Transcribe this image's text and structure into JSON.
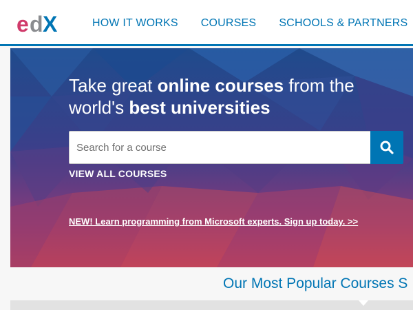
{
  "logo": {
    "text": "edX",
    "colors": {
      "e": "#d03a6a",
      "d": "#8a8c8f",
      "x": "#0075b4"
    }
  },
  "nav": {
    "items": [
      {
        "label": "HOW IT WORKS"
      },
      {
        "label": "COURSES"
      },
      {
        "label": "SCHOOLS & PARTNERS"
      }
    ]
  },
  "hero": {
    "title_part1": "Take great ",
    "title_bold1": "online courses",
    "title_part2": " from the",
    "title_part3": "world's ",
    "title_bold2": "best universities",
    "search": {
      "placeholder": "Search for a course",
      "value": ""
    },
    "search_icon": "search-icon",
    "view_all": "VIEW ALL COURSES",
    "promo": "NEW! Learn programming from Microsoft experts. Sign up today. >>"
  },
  "popular": {
    "title": "Our Most Popular Courses S"
  },
  "colors": {
    "accent": "#0075b4",
    "header_border": "#0075b4"
  }
}
